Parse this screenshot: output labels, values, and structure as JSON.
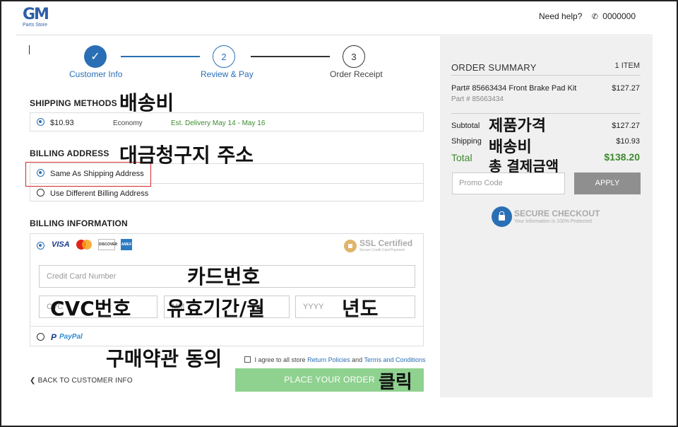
{
  "header": {
    "logo_main": "GM",
    "logo_sub": "Parts Store",
    "help_text": "Need help?",
    "phone": "0000000"
  },
  "steps": [
    {
      "number": "✓",
      "label": "Customer Info"
    },
    {
      "number": "2",
      "label": "Review & Pay"
    },
    {
      "number": "3",
      "label": "Order Receipt"
    }
  ],
  "shipping": {
    "title": "SHIPPING METHODS",
    "price": "$10.93",
    "type": "Economy",
    "eta": "Est. Delivery May 14 - May 16"
  },
  "billing_address": {
    "title": "BILLING ADDRESS",
    "option_same": "Same As Shipping Address",
    "option_diff": "Use Different Billing Address"
  },
  "billing_info": {
    "title": "BILLING INFORMATION",
    "card_visa": "VISA",
    "card_discover": "DISCOVER",
    "card_amex": "AMEX",
    "ssl_title": "SSL Certified",
    "ssl_sub": "Secure Credit Card Payment",
    "cc_placeholder": "Credit Card Number",
    "cvc_placeholder": "CVC",
    "month_placeholder": "MM",
    "year_placeholder": "YYYY",
    "paypal_label": "PayPal"
  },
  "agreement": {
    "prefix": "I agree to all store",
    "link1": "Return Policies",
    "mid": "and",
    "link2": "Terms and Conditions"
  },
  "actions": {
    "back": "BACK TO CUSTOMER INFO",
    "place_order": "PLACE YOUR ORDER"
  },
  "summary": {
    "title": "ORDER SUMMARY",
    "count": "1 ITEM",
    "item_name": "Part# 85663434 Front Brake Pad Kit",
    "item_part": "Part # 85663434",
    "item_price": "$127.27",
    "subtotal_label": "Subtotal",
    "subtotal_value": "$127.27",
    "shipping_label": "Shipping",
    "shipping_value": "$10.93",
    "total_label": "Total",
    "total_value": "$138.20",
    "promo_placeholder": "Promo Code",
    "apply": "APPLY",
    "secure_title": "SECURE CHECKOUT",
    "secure_sub": "Your Information is 100% Protected"
  },
  "annotations": {
    "shipping_fee": "배송비",
    "billing_address": "대금청구지 주소",
    "card_number": "카드번호",
    "cvc": "CVC번호",
    "expiry_month": "유효기간/월",
    "year": "년도",
    "agree_terms": "구매약관 동의",
    "click": "클릭",
    "product_price": "제품가격",
    "shipping_fee_2": "배송비",
    "total_payment": "총 결제금액"
  },
  "colors": {
    "accent": "#2a6fb5",
    "green": "#3d8b2f",
    "place_button": "#8fd18f",
    "highlight": "#d42a2a"
  }
}
